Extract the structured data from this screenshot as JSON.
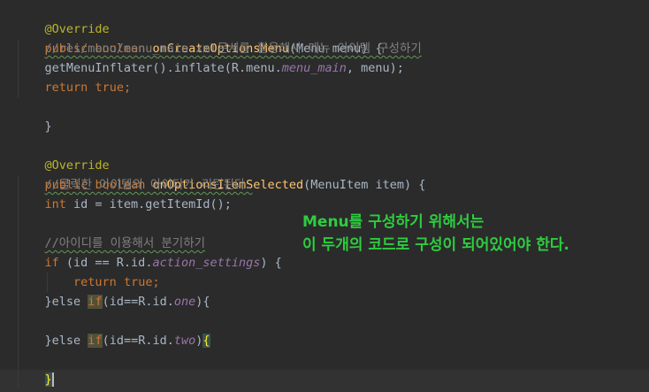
{
  "code": {
    "annotation_1": "@Override",
    "sig1_public": "public",
    "sig1_type": "boolean",
    "sig1_name": "onCreateOptionsMenu",
    "sig1_params": "(Menu menu) {",
    "comment_1": "//res/menu/menu_main.xml문서를 활용해서 메뉴 아이템 구성하기",
    "inflate_call_a": "getMenuInflater().inflate(R.menu.",
    "inflate_menu_main": "menu_main",
    "inflate_call_b": ", menu);",
    "return_kw_1": "return",
    "return_val_1": "true",
    "semicolon": ";",
    "close_brace": "}",
    "annotation_2": "@Override",
    "sig2_public": "public",
    "sig2_type": "boolean",
    "sig2_name": "onOptionsItemSelected",
    "sig2_params": "(MenuItem item) {",
    "comment_2": "//클릭한 아이템의 아이디가 리턴된다.",
    "int_kw": "int",
    "id_assign": " id = item.getItemId();",
    "comment_3": "//아이디를 이용해서 분기하기",
    "if_kw": "if",
    "if_cond_a": " (id == R.id.",
    "if_action_settings": "action_settings",
    "if_cond_b": ") {",
    "return_kw_2": "return",
    "return_val_2": "true",
    "else_kw_1": "}else",
    "elif_if_1": "if",
    "elif_cond_1a": "(id==R.id.",
    "elif_one": "one",
    "elif_cond_1b": "){",
    "else_kw_2": "}else",
    "elif_if_2": "if",
    "elif_cond_2a": "(id==R.id.",
    "elif_two": "two",
    "elif_cond_2b": ")",
    "open_brace_match": "{",
    "caret_brace": "}"
  },
  "note": {
    "line1": "Menu를 구성하기 위해서는",
    "line2": "이 두개의 코드로 구성이 되어있어야 한다."
  },
  "colors": {
    "background": "#2b2b2b",
    "keyword": "#cc7832",
    "annotation": "#bbb529",
    "method": "#ffc66d",
    "comment": "#808080",
    "field": "#9876aa",
    "text": "#a9b7c6",
    "note": "#2ecc40"
  }
}
